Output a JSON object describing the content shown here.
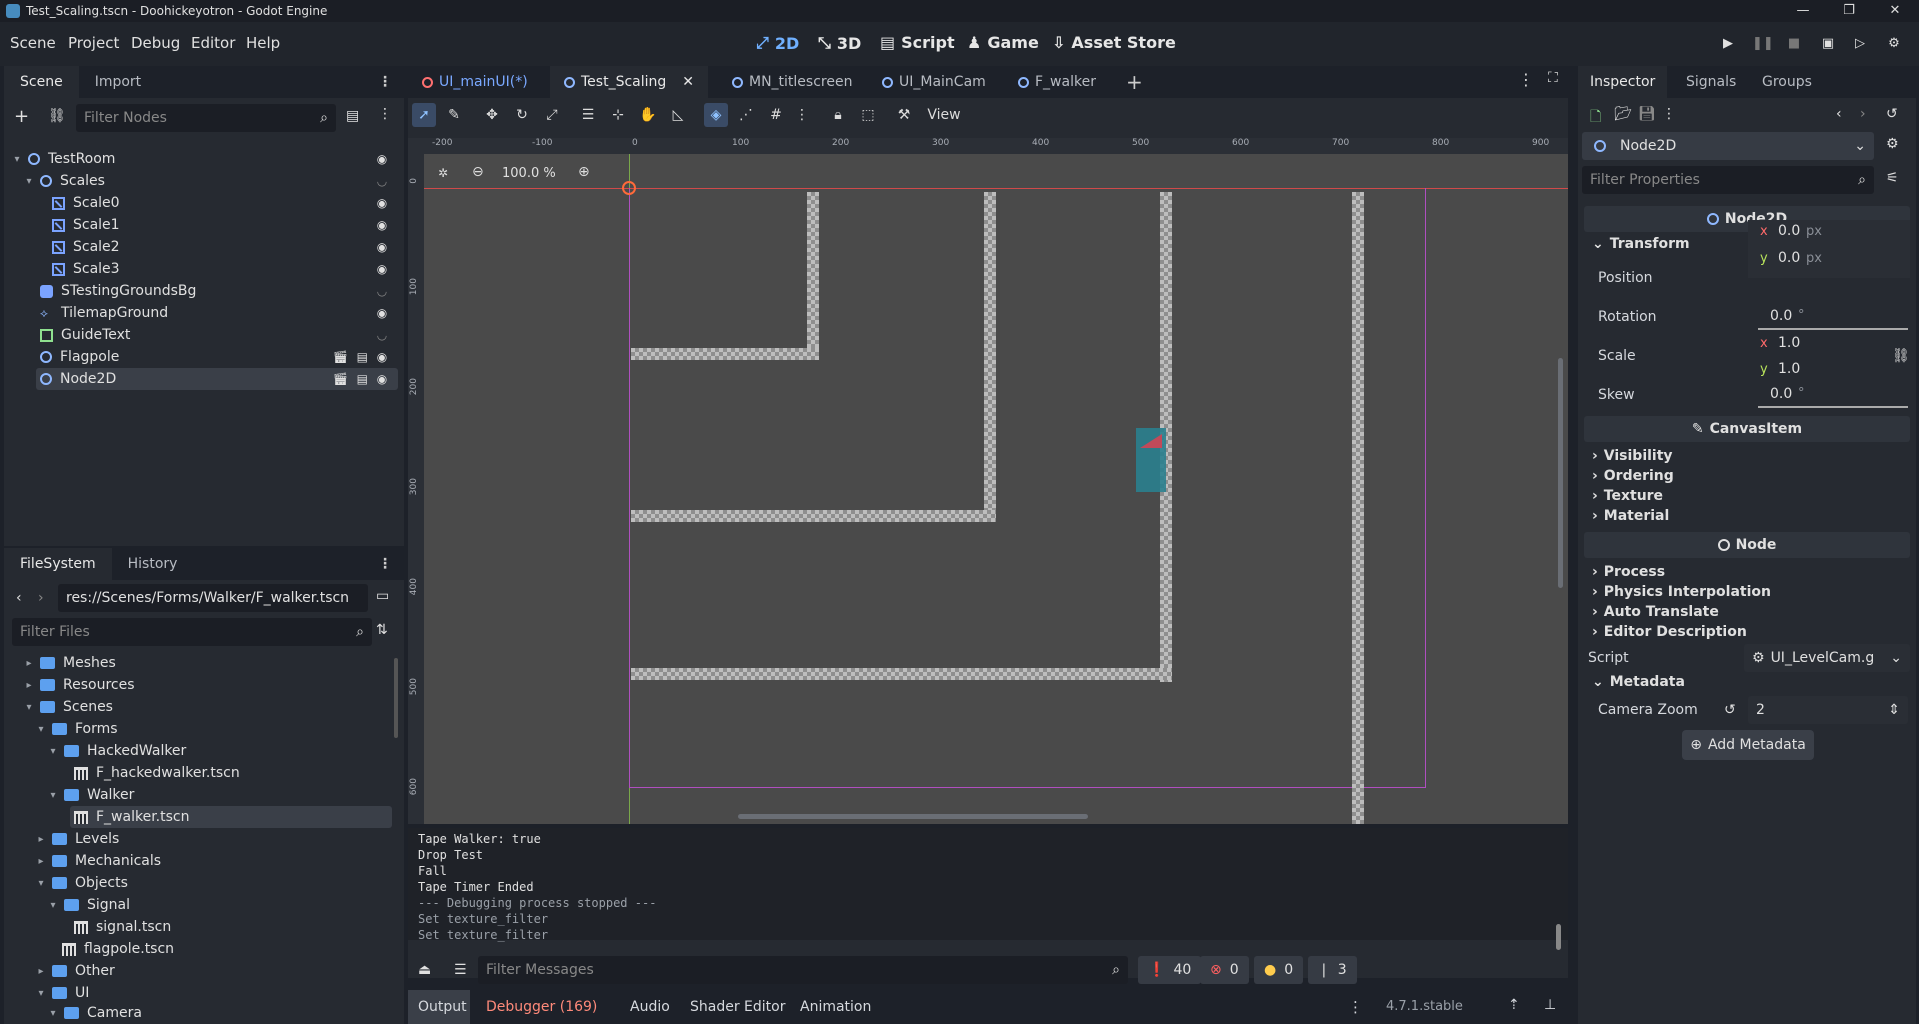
{
  "window": {
    "title": "Test_Scaling.tscn - Doohickeyotron - Godot Engine"
  },
  "menu": {
    "items": [
      "Scene",
      "Project",
      "Debug",
      "Editor",
      "Help"
    ]
  },
  "main_screens": {
    "d2": "2D",
    "d3": "3D",
    "script": "Script",
    "game": "Game",
    "asset": "Asset Store"
  },
  "scene_dock": {
    "tabs": [
      "Scene",
      "Import"
    ],
    "filter_placeholder": "Filter Nodes",
    "nodes": [
      "TestRoom",
      "Scales",
      "Scale0",
      "Scale1",
      "Scale2",
      "Scale3",
      "STestingGroundsBg",
      "TilemapGround",
      "GuideText",
      "Flagpole",
      "Node2D"
    ]
  },
  "filesystem": {
    "tabs": [
      "FileSystem",
      "History"
    ],
    "path": "res://Scenes/Forms/Walker/F_walker.tscn",
    "filter_placeholder": "Filter Files",
    "items": [
      "Meshes",
      "Resources",
      "Scenes",
      "Forms",
      "HackedWalker",
      "F_hackedwalker.tscn",
      "Walker",
      "F_walker.tscn",
      "Levels",
      "Mechanicals",
      "Objects",
      "Signal",
      "signal.tscn",
      "flagpole.tscn",
      "Other",
      "UI",
      "Camera"
    ]
  },
  "editor_tabs": [
    "UI_mainUI(*)",
    "Test_Scaling",
    "MN_titlescreen",
    "UI_MainCam",
    "F_walker"
  ],
  "toolbar": {
    "view": "View",
    "zoom": "100.0 %"
  },
  "ruler": {
    "x": [
      "-200",
      "-100",
      "0",
      "100",
      "200",
      "300",
      "400",
      "500",
      "600",
      "700",
      "800",
      "900"
    ],
    "y": [
      "0",
      "100",
      "200",
      "300",
      "400",
      "500",
      "600"
    ]
  },
  "output": {
    "lines": [
      "Tape Walker: true",
      "Drop Test",
      "Fall",
      "Tape Timer Ended",
      "--- Debugging process stopped ---",
      "Set texture_filter",
      "Set texture_filter"
    ],
    "filter_placeholder": "Filter Messages",
    "counts": {
      "messages": "40",
      "errors": "0",
      "warnings": "0",
      "info": "3"
    }
  },
  "bottom_tabs": {
    "output": "Output",
    "debugger": "Debugger (169)",
    "audio": "Audio",
    "shader": "Shader Editor",
    "animation": "Animation",
    "version": "4.7.1.stable"
  },
  "inspector": {
    "tabs": [
      "Inspector",
      "Signals",
      "Groups"
    ],
    "node_type": "Node2D",
    "filter_placeholder": "Filter Properties",
    "class_node2d": "Node2D",
    "transform": "Transform",
    "position_label": "Position",
    "pos_x": "0.0",
    "pos_y": "0.0",
    "px": "px",
    "rotation_label": "Rotation",
    "rotation": "0.0",
    "deg": "°",
    "scale_label": "Scale",
    "scale_x": "1.0",
    "scale_y": "1.0",
    "skew_label": "Skew",
    "skew": "0.0",
    "class_canvas": "CanvasItem",
    "visibility": "Visibility",
    "ordering": "Ordering",
    "texture": "Texture",
    "material": "Material",
    "class_node": "Node",
    "process": "Process",
    "physics": "Physics Interpolation",
    "autotranslate": "Auto Translate",
    "editordesc": "Editor Description",
    "script_label": "Script",
    "script_value": "UI_LevelCam.g",
    "metadata": "Metadata",
    "camzoom_label": "Camera Zoom",
    "camzoom_value": "2",
    "add_metadata": "Add Metadata",
    "x": "x",
    "y": "y"
  },
  "colors": {
    "accent": "#70b0ff",
    "bg": "#1d2129",
    "panel": "#262a31",
    "viewport": "#4a4a4a"
  }
}
